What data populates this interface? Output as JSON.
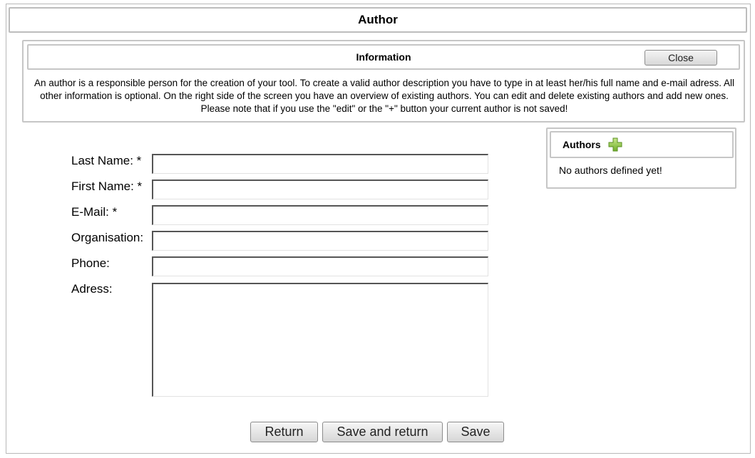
{
  "window": {
    "title": "Author"
  },
  "info": {
    "heading": "Information",
    "close_label": "Close",
    "text": "An author is a responsible person for the creation of your tool. To create a valid author description you have to type in at least her/his full name and e-mail adress. All other information is optional. On the right side of the screen you have an overview of existing authors. You can edit and delete existing authors and add new ones. Please note that if you use the \"edit\" or the \"+\" button your current author is not saved!"
  },
  "authors": {
    "heading": "Authors",
    "add_icon": "plus-icon",
    "add_icon_color": "#8cc63f",
    "empty_text": "No authors defined yet!"
  },
  "form": {
    "last_name_label": "Last Name: *",
    "last_name_value": "",
    "first_name_label": "First Name: *",
    "first_name_value": "",
    "email_label": "E-Mail: *",
    "email_value": "",
    "organisation_label": "Organisation:",
    "organisation_value": "",
    "phone_label": "Phone:",
    "phone_value": "",
    "address_label": "Adress:",
    "address_value": ""
  },
  "buttons": {
    "return_label": "Return",
    "save_return_label": "Save and return",
    "save_label": "Save"
  }
}
